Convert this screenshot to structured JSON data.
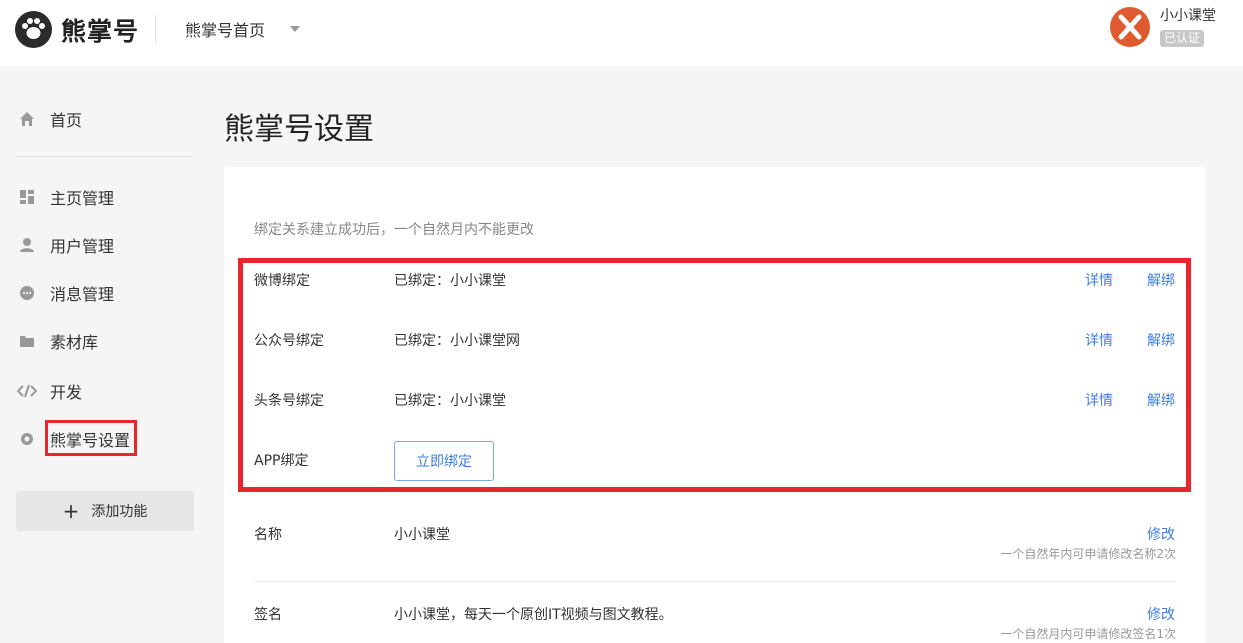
{
  "header": {
    "logo_text": "熊掌号",
    "nav_title": "熊掌号首页",
    "user_name": "小小课堂",
    "verified": "已认证"
  },
  "sidebar": {
    "items": [
      {
        "label": "首页",
        "icon": "home-icon"
      },
      {
        "label": "主页管理",
        "icon": "dashboard-icon"
      },
      {
        "label": "用户管理",
        "icon": "user-icon"
      },
      {
        "label": "消息管理",
        "icon": "message-icon"
      },
      {
        "label": "素材库",
        "icon": "folder-icon"
      },
      {
        "label": "开发",
        "icon": "code-icon"
      },
      {
        "label": "熊掌号设置",
        "icon": "gear-icon"
      }
    ],
    "add_feature": "添加功能"
  },
  "main": {
    "title": "熊掌号设置",
    "hint": "绑定关系建立成功后，一个自然月内不能更改",
    "bindings": [
      {
        "label": "微博绑定",
        "value": "已绑定：小小课堂",
        "detail": "详情",
        "unbind": "解绑"
      },
      {
        "label": "公众号绑定",
        "value": "已绑定：小小课堂网",
        "detail": "详情",
        "unbind": "解绑"
      },
      {
        "label": "头条号绑定",
        "value": "已绑定：小小课堂",
        "detail": "详情",
        "unbind": "解绑"
      },
      {
        "label": "APP绑定",
        "button": "立即绑定"
      }
    ],
    "name_row": {
      "label": "名称",
      "value": "小小课堂",
      "action": "修改",
      "note": "一个自然年内可申请修改名称2次"
    },
    "signature_row": {
      "label": "签名",
      "value": "小小课堂，每天一个原创IT视频与图文教程。",
      "action": "修改",
      "note": "一个自然月内可申请修改签名1次"
    }
  },
  "colors": {
    "accent": "#3d7ee2",
    "highlight": "#e8262e",
    "avatar": "#e05a2f"
  }
}
